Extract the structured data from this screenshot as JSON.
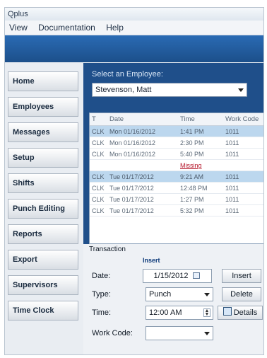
{
  "window": {
    "title": "Qplus"
  },
  "menu": [
    "View",
    "Documentation",
    "Help"
  ],
  "sidebar": {
    "items": [
      {
        "label": "Home"
      },
      {
        "label": "Employees"
      },
      {
        "label": "Messages"
      },
      {
        "label": "Setup"
      },
      {
        "label": "Shifts"
      },
      {
        "label": "Punch Editing"
      },
      {
        "label": "Reports"
      },
      {
        "label": "Export"
      },
      {
        "label": "Supervisors"
      },
      {
        "label": "Time Clock"
      }
    ]
  },
  "employee": {
    "select_label": "Select an Employee:",
    "selected": "Stevenson, Matt"
  },
  "grid": {
    "headers": [
      "T",
      "Date",
      "Time",
      "Work Code"
    ],
    "rows": [
      {
        "t": "CLK",
        "date": "Mon 01/16/2012",
        "time": "1:41 PM",
        "code": "1011",
        "selected": true
      },
      {
        "t": "CLK",
        "date": "Mon 01/16/2012",
        "time": "2:30 PM",
        "code": "1011",
        "selected": false
      },
      {
        "t": "CLK",
        "date": "Mon 01/16/2012",
        "time": "5:40 PM",
        "code": "1011",
        "selected": false
      },
      {
        "t": "",
        "date": "",
        "time": "Missing",
        "code": "",
        "selected": false,
        "missing": true
      },
      {
        "t": "CLK",
        "date": "Tue 01/17/2012",
        "time": "9:21 AM",
        "code": "1011",
        "selected": true
      },
      {
        "t": "CLK",
        "date": "Tue 01/17/2012",
        "time": "12:48 PM",
        "code": "1011",
        "selected": false
      },
      {
        "t": "CLK",
        "date": "Tue 01/17/2012",
        "time": "1:27 PM",
        "code": "1011",
        "selected": false
      },
      {
        "t": "CLK",
        "date": "Tue 01/17/2012",
        "time": "5:32 PM",
        "code": "1011",
        "selected": false
      }
    ]
  },
  "transaction": {
    "title": "Transaction",
    "mode": "Insert",
    "date_label": "Date:",
    "date_value": "1/15/2012",
    "type_label": "Type:",
    "type_value": "Punch",
    "time_label": "Time:",
    "time_value": "12:00 AM",
    "workcode_label": "Work Code:",
    "workcode_value": "",
    "insert_button": "Insert",
    "delete_button": "Delete",
    "details_button": "Details"
  }
}
